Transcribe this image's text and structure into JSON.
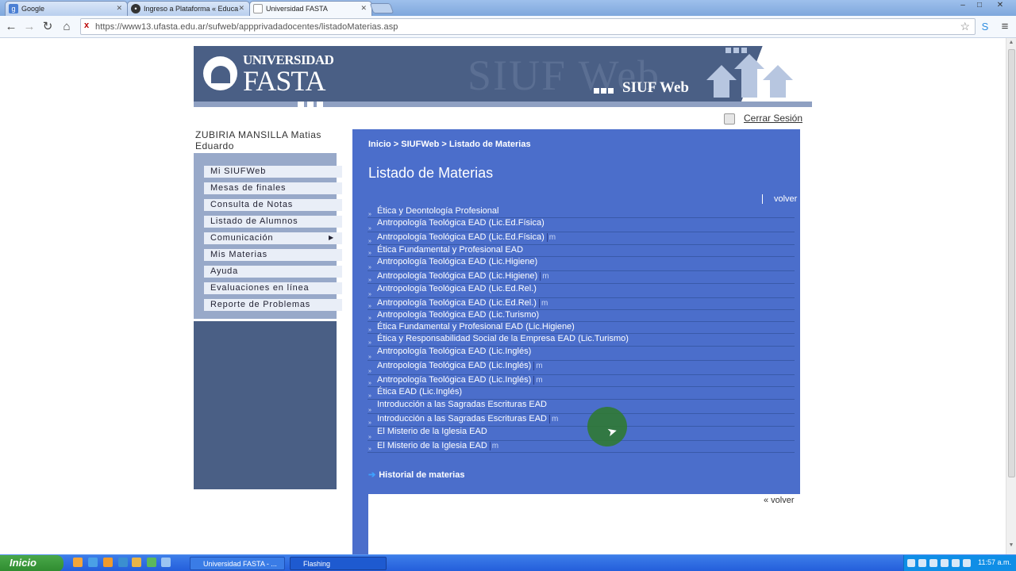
{
  "browser": {
    "tabs": [
      {
        "label": "Google",
        "icon": "google-icon"
      },
      {
        "label": "Ingreso a Plataforma « Educa",
        "icon": "web-icon"
      },
      {
        "label": "Universidad FASTA",
        "icon": "page-icon"
      }
    ],
    "url": "https://www13.ufasta.edu.ar/sufweb/appprivadadocentes/listadoMaterias.asp"
  },
  "header": {
    "logo_line1": "UNIVERSIDAD",
    "logo_line2": "FASTA",
    "watermark": "SIUF Web",
    "app_name": "SIUF Web",
    "logout": "Cerrar Sesión"
  },
  "user": {
    "name": "ZUBIRIA MANSILLA Matias Eduardo"
  },
  "sidebar": {
    "items": [
      {
        "label": "Mi SIUFWeb"
      },
      {
        "label": "Mesas de finales"
      },
      {
        "label": "Consulta de Notas"
      },
      {
        "label": "Listado de Alumnos"
      },
      {
        "label": "Comunicación",
        "submenu": "▶"
      },
      {
        "label": "Mis Materias"
      },
      {
        "label": "Ayuda"
      },
      {
        "label": "Evaluaciones en línea"
      },
      {
        "label": "Reporte de Problemas"
      }
    ]
  },
  "main": {
    "breadcrumb": "Inicio > SIUFWeb > Listado de Materias",
    "title": "Listado de Materias",
    "volver": "volver",
    "bullet": "»",
    "marker": "m",
    "courses": [
      {
        "name": "Ética y Deontología Profesional",
        "marked": false
      },
      {
        "name": "Antropología Teológica EAD (Lic.Ed.Física)",
        "marked": false
      },
      {
        "name": "Antropología Teológica EAD (Lic.Ed.Física)",
        "marked": true
      },
      {
        "name": "Ética Fundamental y Profesional EAD",
        "marked": false
      },
      {
        "name": "Antropología Teológica EAD (Lic.Higiene)",
        "marked": false
      },
      {
        "name": "Antropología Teológica EAD (Lic.Higiene)",
        "marked": true
      },
      {
        "name": "Antropología Teológica EAD (Lic.Ed.Rel.)",
        "marked": false
      },
      {
        "name": "Antropología Teológica EAD (Lic.Ed.Rel.)",
        "marked": true
      },
      {
        "name": "Antropología Teológica EAD (Lic.Turismo)",
        "marked": false
      },
      {
        "name": "Ética Fundamental y Profesional EAD (Lic.Higiene)",
        "marked": false
      },
      {
        "name": "Ética y Responsabilidad Social de la Empresa EAD (Lic.Turismo)",
        "marked": false
      },
      {
        "name": "Antropología Teológica EAD (Lic.Inglés)",
        "marked": false
      },
      {
        "name": "Antropología Teológica EAD (Lic.Inglés)",
        "marked": true
      },
      {
        "name": "Antropología Teológica EAD (Lic.Inglés)",
        "marked": true
      },
      {
        "name": "Ética EAD (Lic.Inglés)",
        "marked": false
      },
      {
        "name": "Introducción a las Sagradas Escrituras EAD",
        "marked": false
      },
      {
        "name": "Introducción a las Sagradas Escrituras EAD",
        "marked": true
      },
      {
        "name": "El Misterio de la Iglesia EAD",
        "marked": false
      },
      {
        "name": "El Misterio de la Iglesia EAD",
        "marked": true
      }
    ],
    "history_link": "Historial de materias",
    "volver_bottom": "« volver"
  },
  "taskbar": {
    "start": "Inicio",
    "tasks": [
      {
        "label": "Universidad FASTA - ..."
      },
      {
        "label": "Flashing"
      }
    ],
    "clock": "11:57 a.m."
  },
  "colors": {
    "main_bg": "#4b6ecb",
    "banner": "#4a5f85",
    "sidebar": "#98a9c9"
  }
}
